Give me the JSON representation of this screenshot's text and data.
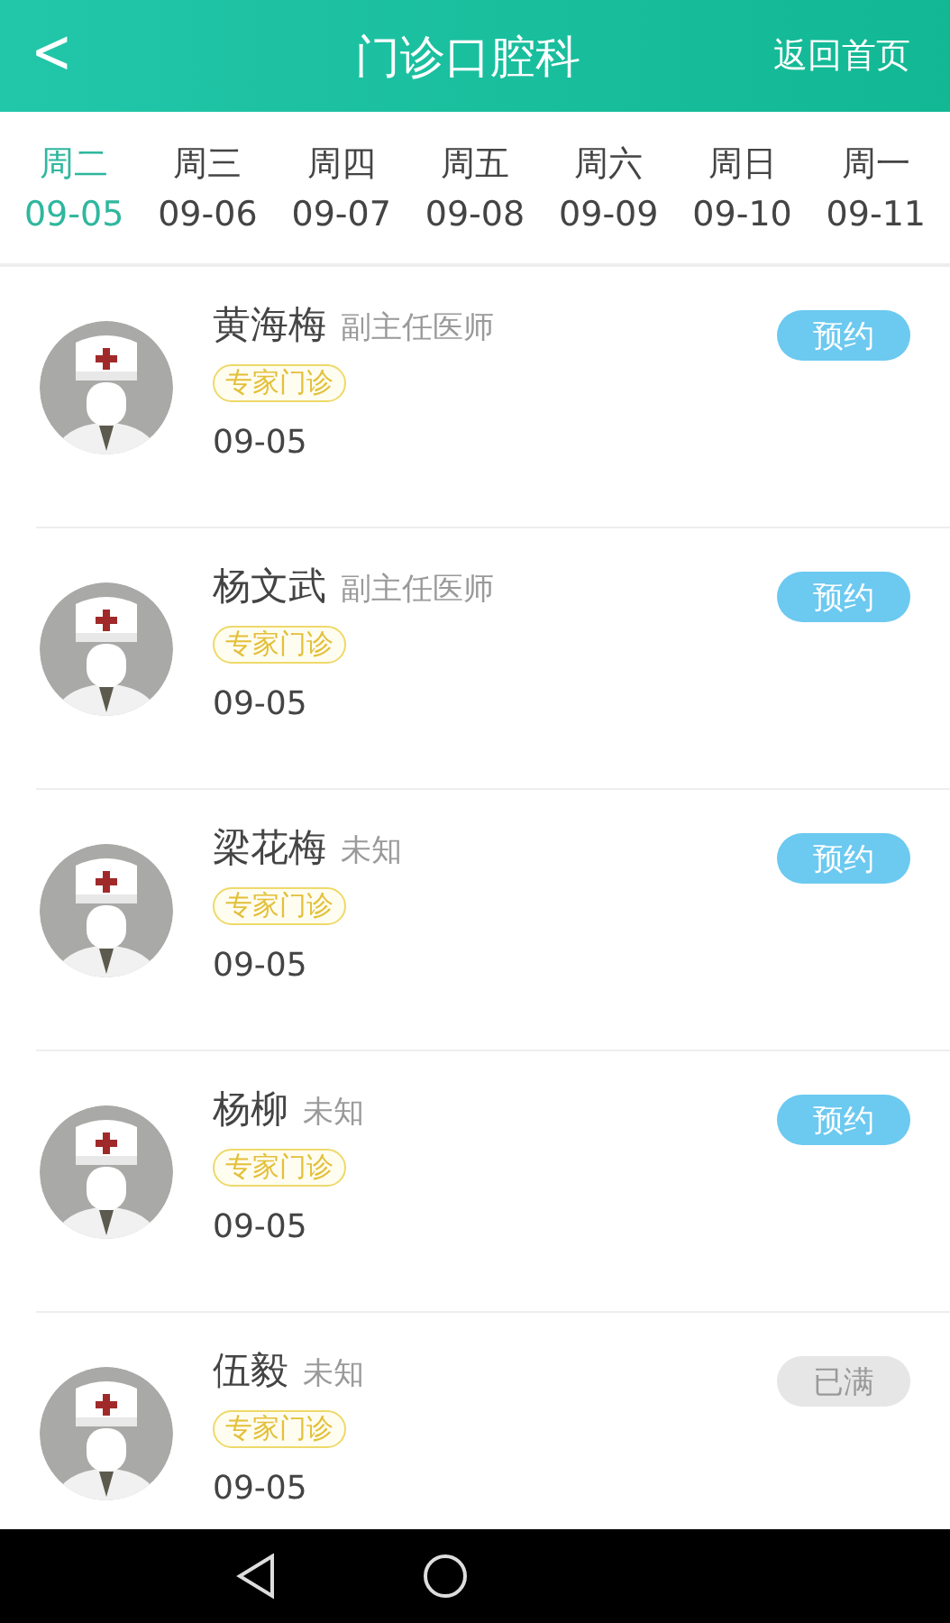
{
  "header": {
    "back": "<",
    "title": "门诊口腔科",
    "home_link": "返回首页"
  },
  "days": [
    {
      "weekday": "周二",
      "date": "09-05",
      "selected": true
    },
    {
      "weekday": "周三",
      "date": "09-06",
      "selected": false
    },
    {
      "weekday": "周四",
      "date": "09-07",
      "selected": false
    },
    {
      "weekday": "周五",
      "date": "09-08",
      "selected": false
    },
    {
      "weekday": "周六",
      "date": "09-09",
      "selected": false
    },
    {
      "weekday": "周日",
      "date": "09-10",
      "selected": false
    },
    {
      "weekday": "周一",
      "date": "09-11",
      "selected": false
    }
  ],
  "doctors": [
    {
      "name": "黄海梅",
      "title": "副主任医师",
      "tag": "专家门诊",
      "date": "09-05",
      "button": "预约",
      "disabled": false
    },
    {
      "name": "杨文武",
      "title": "副主任医师",
      "tag": "专家门诊",
      "date": "09-05",
      "button": "预约",
      "disabled": false
    },
    {
      "name": "梁花梅",
      "title": "未知",
      "tag": "专家门诊",
      "date": "09-05",
      "button": "预约",
      "disabled": false
    },
    {
      "name": "杨柳",
      "title": "未知",
      "tag": "专家门诊",
      "date": "09-05",
      "button": "预约",
      "disabled": false
    },
    {
      "name": "伍毅",
      "title": "未知",
      "tag": "专家门诊",
      "date": "09-05",
      "button": "已满",
      "disabled": true
    }
  ]
}
